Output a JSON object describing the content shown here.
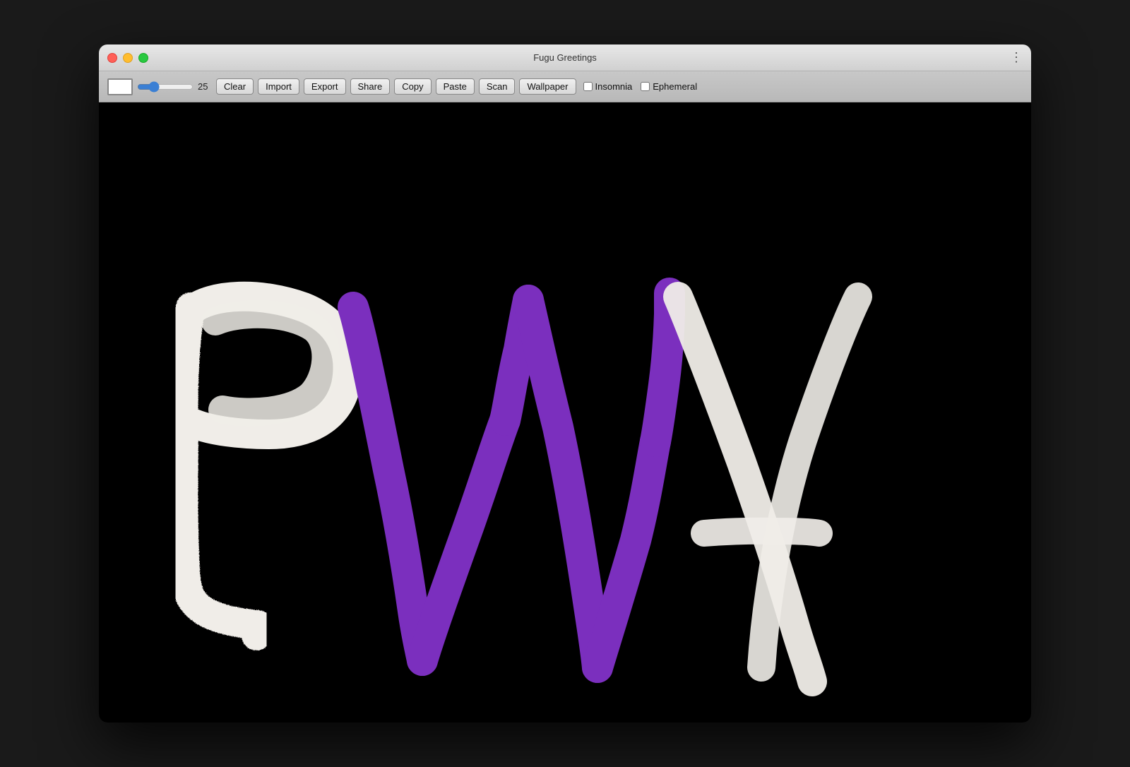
{
  "window": {
    "title": "Fugu Greetings"
  },
  "toolbar": {
    "brush_size": "25",
    "clear_label": "Clear",
    "import_label": "Import",
    "export_label": "Export",
    "share_label": "Share",
    "copy_label": "Copy",
    "paste_label": "Paste",
    "scan_label": "Scan",
    "wallpaper_label": "Wallpaper",
    "insomnia_label": "Insomnia",
    "ephemeral_label": "Ephemeral",
    "insomnia_checked": false,
    "ephemeral_checked": false
  },
  "traffic_lights": {
    "close": "close-icon",
    "minimize": "minimize-icon",
    "maximize": "maximize-icon"
  },
  "menu_icon": "⋮",
  "drawing": {
    "letters": [
      "P",
      "W",
      "A"
    ],
    "colors": {
      "P": "#ffffff",
      "W": "#7b2fbe",
      "A": "#ffffff"
    }
  }
}
